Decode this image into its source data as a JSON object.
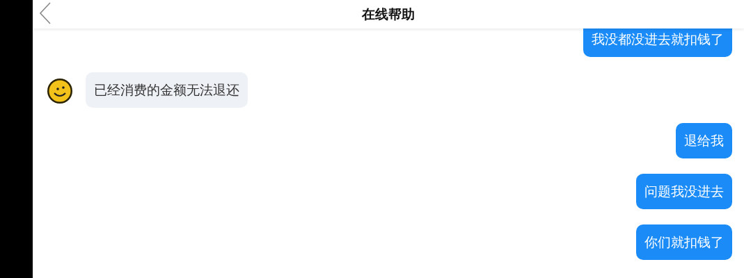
{
  "header": {
    "title": "在线帮助"
  },
  "messages": [
    {
      "kind": "sent",
      "text": "我没都没进去就扣钱了"
    },
    {
      "kind": "received",
      "text": "已经消费的金额无法退还"
    },
    {
      "kind": "sent",
      "text": "退给我"
    },
    {
      "kind": "sent",
      "text": "问题我没进去"
    },
    {
      "kind": "sent",
      "text": "你们就扣钱了"
    }
  ]
}
